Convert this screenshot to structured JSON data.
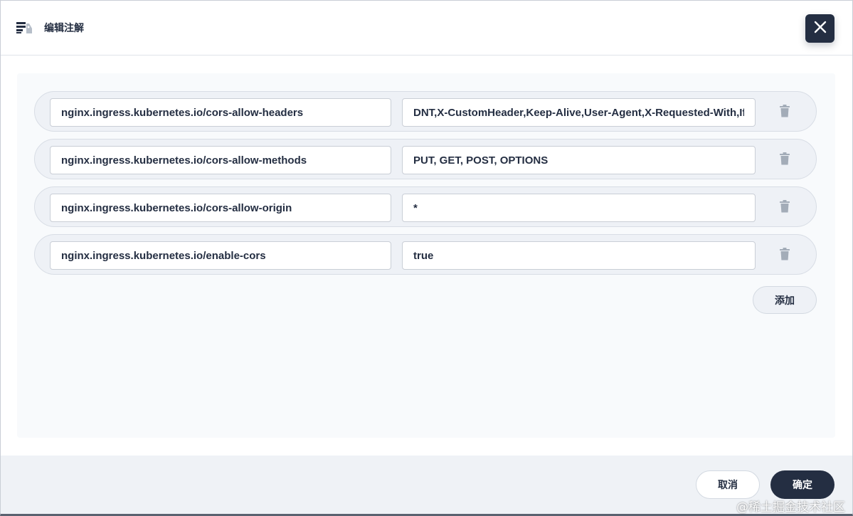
{
  "header": {
    "title": "编辑注解",
    "icon": "annotation-icon",
    "close_icon": "close-icon"
  },
  "annotations": [
    {
      "key": "nginx.ingress.kubernetes.io/cors-allow-headers",
      "value": "DNT,X-CustomHeader,Keep-Alive,User-Agent,X-Requested-With,If-Modified-Since,Cache-Control,Content-Type,Authorization"
    },
    {
      "key": "nginx.ingress.kubernetes.io/cors-allow-methods",
      "value": "PUT, GET, POST, OPTIONS"
    },
    {
      "key": "nginx.ingress.kubernetes.io/cors-allow-origin",
      "value": "*"
    },
    {
      "key": "nginx.ingress.kubernetes.io/enable-cors",
      "value": "true"
    }
  ],
  "actions": {
    "add_label": "添加",
    "cancel_label": "取消",
    "ok_label": "确定"
  },
  "watermark": "@稀土掘金技术社区",
  "colors": {
    "primary": "#242e42",
    "row_bg": "#eef1f6",
    "panel_bg": "#f8fafc",
    "footer_bg": "#eff2f6",
    "trash": "#a3acb8"
  }
}
